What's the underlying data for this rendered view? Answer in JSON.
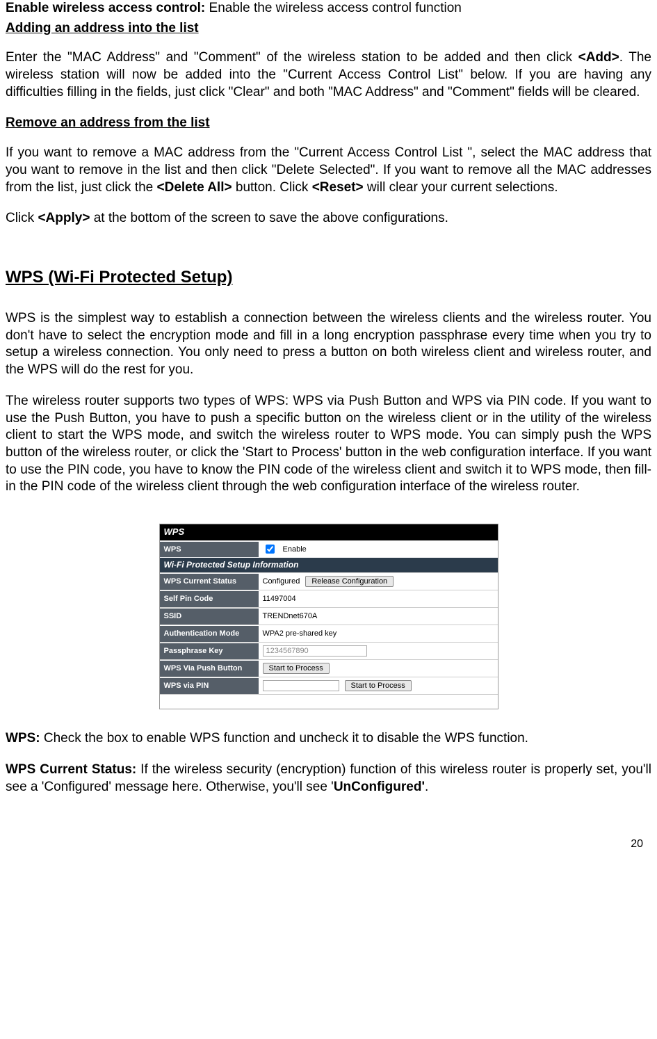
{
  "intro": {
    "enable_label": "Enable wireless access control:",
    "enable_text": " Enable the wireless access control function",
    "adding_title": "Adding an address into the list",
    "adding_p1a": " Enter the \"MAC Address\" and \"Comment\" of the wireless station to be added and then click ",
    "adding_add": "<Add>",
    "adding_p1b": ". The wireless station will now be added into the \"Current Access Control List\" below. If you are having any difficulties filling in the fields, just click \"Clear\" and both \"MAC Address\" and \"Comment\" fields will be cleared.",
    "remove_title": " Remove an address from the list",
    "remove_p1a": "If you want to remove a MAC address from the \"Current Access Control List \", select the MAC address that you want to remove in the list and then click \"Delete Selected\". If you want to remove all the MAC addresses from the list, just click the ",
    "remove_delall": "<Delete All>",
    "remove_p1b": " button. Click ",
    "remove_reset": "<Reset>",
    "remove_p1c": " will clear your current selections.",
    "apply_a": "Click ",
    "apply_btn": "<Apply>",
    "apply_b": " at the bottom of the screen to save the above configurations."
  },
  "wps": {
    "title": "WPS (Wi-Fi Protected Setup)",
    "p1": "WPS is the simplest way to establish a connection between the wireless clients and the wireless router. You don't have to select the encryption mode and fill in a long encryption passphrase every time when you try to setup a wireless connection. You only need to press a button on both wireless client and wireless router, and the WPS will do the rest for you.",
    "p2": "The wireless router supports two types of WPS: WPS via Push Button and WPS via PIN code. If you want to use the Push Button, you have to push a specific button on the wireless client or in the utility of the wireless client to start the WPS mode, and switch the wireless router to WPS mode. You can simply push the WPS button of the wireless router, or click the 'Start to Process' button in the web configuration interface. If you want to use the PIN code, you have to know the PIN code of the wireless client and switch it to WPS mode, then fill-in the PIN code of the wireless client through the web configuration interface of the wireless router."
  },
  "screenshot": {
    "header": "WPS",
    "enable_label": "WPS",
    "enable_check": "Enable",
    "info_header": "Wi-Fi Protected Setup Information",
    "rows": {
      "status_label": "WPS Current Status",
      "status_value": "Configured",
      "release_btn": "Release Configuration",
      "pin_label": "Self Pin Code",
      "pin_value": "11497004",
      "ssid_label": "SSID",
      "ssid_value": "TRENDnet670A",
      "auth_label": "Authentication Mode",
      "auth_value": "WPA2 pre-shared key",
      "pass_label": "Passphrase Key",
      "pass_value": "1234567890",
      "push_label": "WPS Via Push Button",
      "push_btn": "Start to Process",
      "pinvia_label": "WPS via PIN",
      "pinvia_btn": "Start to Process"
    }
  },
  "descriptions": {
    "wps_label": "WPS:",
    "wps_text": " Check the box to enable WPS function and uncheck it to disable the WPS function.",
    "status_label": "WPS Current Status:",
    "status_text_a": " If the wireless security (encryption) function of this wireless router is properly set, you'll see a 'Configured' message here. Otherwise, you'll see '",
    "status_unconf": "UnConfigured'",
    "status_text_b": "."
  },
  "page_number": "20"
}
